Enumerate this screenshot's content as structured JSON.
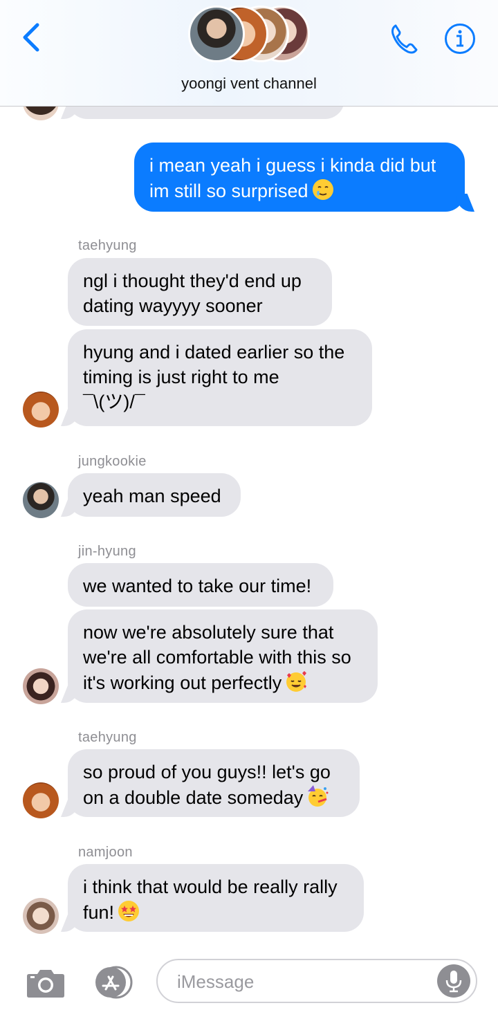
{
  "header": {
    "group_name": "yoongi vent channel",
    "back_icon": "chevron-left-icon",
    "call_icon": "phone-icon",
    "info_icon": "info-icon"
  },
  "messages": [
    {
      "type": "outgoing",
      "lines": [
        "i mean yeah i guess i kinda did but",
        "im still so surprised"
      ],
      "emoji": "face-holding-back-tears"
    },
    {
      "type": "sender",
      "name": "taehyung"
    },
    {
      "type": "incoming",
      "lines": [
        "ngl i thought they'd end up",
        "dating wayyyy sooner"
      ]
    },
    {
      "type": "incoming",
      "lines": [
        "hyung and i dated earlier so the",
        "timing is just right to me",
        "¯\\(ツ)/¯"
      ]
    },
    {
      "type": "sender",
      "name": "jungkookie"
    },
    {
      "type": "incoming",
      "lines": [
        "yeah man speed"
      ]
    },
    {
      "type": "sender",
      "name": "jin-hyung"
    },
    {
      "type": "incoming",
      "lines": [
        "we wanted to take our time!"
      ]
    },
    {
      "type": "incoming",
      "lines": [
        "now we're absolutely sure that",
        "we're all comfortable with this so",
        "it's working out perfectly"
      ],
      "emoji": "smiling-face-with-hearts"
    },
    {
      "type": "sender",
      "name": "taehyung"
    },
    {
      "type": "incoming",
      "lines": [
        "so proud of you guys!! let's go",
        "on a double date someday"
      ],
      "emoji": "partying-face"
    },
    {
      "type": "sender",
      "name": "namjoon"
    },
    {
      "type": "incoming",
      "lines": [
        "i think that would be really rally",
        "fun!"
      ],
      "emoji": "star-struck"
    }
  ],
  "composer": {
    "placeholder": "iMessage",
    "camera_icon": "camera-icon",
    "apps_icon": "app-store-icon",
    "mic_icon": "microphone-icon"
  },
  "colors": {
    "accent": "#0b7cff",
    "incoming_bubble": "#e5e5ea",
    "sender_name": "#8e8e93"
  }
}
